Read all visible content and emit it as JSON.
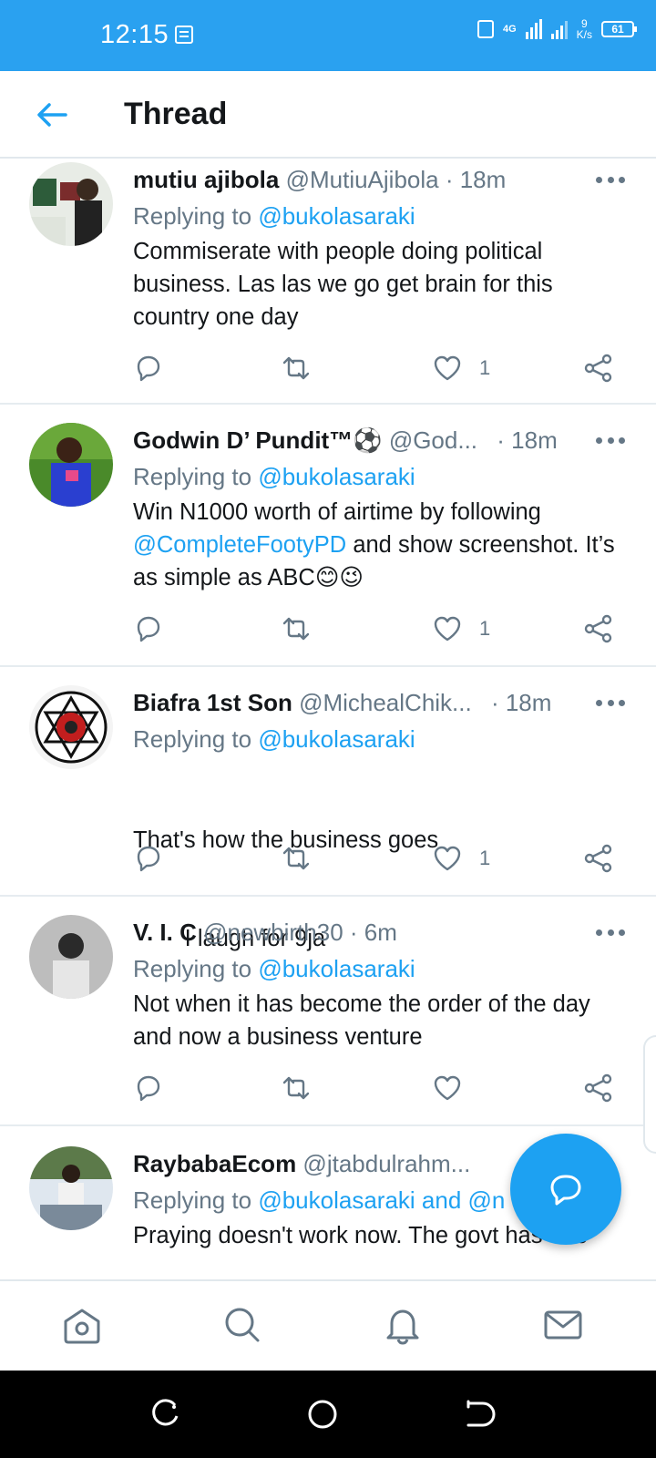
{
  "status_bar": {
    "time": "12:15",
    "network": "4G",
    "speed_value": "9",
    "speed_unit": "K/s",
    "battery": "61"
  },
  "header": {
    "title": "Thread"
  },
  "tweets": [
    {
      "name": "mutiu ajibola",
      "handle": "@MutiuAjibola",
      "time": "· 18m",
      "replying_prefix": "Replying to ",
      "replying_to": "@bukolasaraki",
      "text": "Commiserate with people doing political business. Las las we go get brain for this country one day",
      "likes": "1"
    },
    {
      "name": "Godwin D’ Pundit™⚽",
      "handle": "@God...",
      "time": "· 18m",
      "replying_prefix": "Replying to ",
      "replying_to": "@bukolasaraki",
      "text_part1": "Win N1000 worth of airtime by following ",
      "text_link": "@CompleteFootyPD",
      "text_part2": " and show screenshot. It’s as simple as ABC😊😉",
      "likes": "1"
    },
    {
      "name": "Biafra 1st Son",
      "handle": "@MichealChik...",
      "time": "· 18m",
      "replying_prefix": "Replying to ",
      "replying_to": "@bukolasaraki",
      "text_line1": "That's how the business goes",
      "text_line2": "        I laugh for 9ja",
      "likes": "1"
    },
    {
      "name": "V. I. C",
      "handle": "@newbirth30",
      "time": "· 6m",
      "replying_prefix": "Replying to ",
      "replying_to": "@bukolasaraki",
      "text": "Not when it has become the order of the day and now a business venture",
      "likes": ""
    },
    {
      "name": "RaybabaEcom",
      "handle": "@jtabdulrahm...",
      "time": "",
      "replying_prefix": "Replying to ",
      "replying_to": "@bukolasaraki and @n",
      "text": "Praying doesn't work now. The govt has one",
      "likes": ""
    }
  ],
  "icons": {
    "back": "arrow-left-icon",
    "reply": "reply-icon",
    "retweet": "retweet-icon",
    "like": "heart-icon",
    "share": "share-icon",
    "compose": "compose-reply-icon"
  },
  "colors": {
    "accent": "#1da1f2",
    "status_bar": "#2aa1f0",
    "secondary_text": "#657786"
  }
}
